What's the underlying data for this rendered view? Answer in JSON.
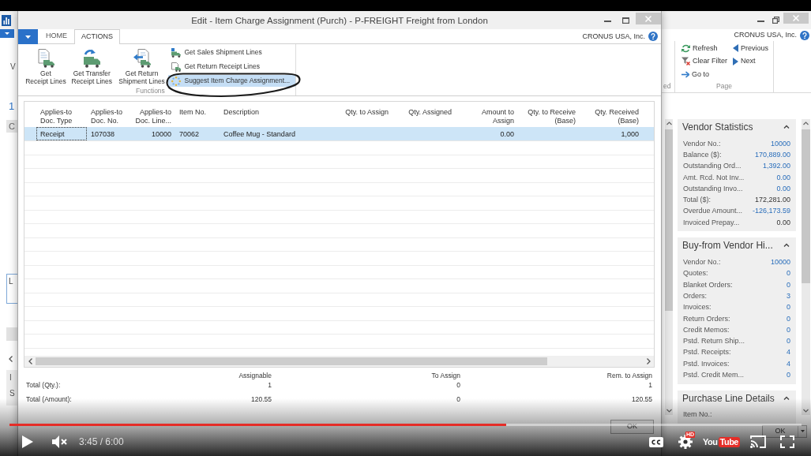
{
  "main_window": {
    "company": "CRONUS USA, Inc.",
    "left_fragments": [
      "V",
      "1",
      "C",
      "L",
      "I",
      "S"
    ],
    "ribbon": {
      "cut_group_label": "ed",
      "page_group": {
        "label": "Page",
        "columns": [
          [
            {
              "label": "Refresh",
              "kind": "refresh"
            },
            {
              "label": "Clear Filter",
              "kind": "clear_filter"
            },
            {
              "label": "Go to",
              "kind": "go_to"
            }
          ],
          [
            {
              "label": "Previous",
              "kind": "previous"
            },
            {
              "label": "Next",
              "kind": "next"
            }
          ]
        ]
      }
    },
    "factboxes": [
      {
        "title": "Vendor Statistics",
        "expanded": true,
        "fields": [
          {
            "label": "Vendor No.:",
            "value": "10000",
            "link": true
          },
          {
            "label": "Balance ($):",
            "value": "170,889.00",
            "link": true
          },
          {
            "label": "Outstanding Ord...",
            "value": "1,392.00",
            "link": true
          },
          {
            "label": "Amt. Rcd. Not Inv...",
            "value": "0.00",
            "link": true
          },
          {
            "label": "Outstanding Invo...",
            "value": "0.00",
            "link": true
          },
          {
            "label": "Total ($):",
            "value": "172,281.00",
            "link": false
          },
          {
            "label": "Overdue Amount...",
            "value": "-126,173.59",
            "link": true
          },
          {
            "label": "Invoiced Prepay...",
            "value": "0.00",
            "link": false
          }
        ]
      },
      {
        "title": "Buy-from Vendor Hi...",
        "expanded": true,
        "fields": [
          {
            "label": "Vendor No.:",
            "value": "10000",
            "link": true
          },
          {
            "label": "Quotes:",
            "value": "0",
            "link": true
          },
          {
            "label": "Blanket Orders:",
            "value": "0",
            "link": true
          },
          {
            "label": "Orders:",
            "value": "3",
            "link": true
          },
          {
            "label": "Invoices:",
            "value": "0",
            "link": true
          },
          {
            "label": "Return Orders:",
            "value": "0",
            "link": true
          },
          {
            "label": "Credit Memos:",
            "value": "0",
            "link": true
          },
          {
            "label": "Pstd. Return Ship...",
            "value": "0",
            "link": true
          },
          {
            "label": "Pstd. Receipts:",
            "value": "4",
            "link": true
          },
          {
            "label": "Pstd. Invoices:",
            "value": "4",
            "link": true
          },
          {
            "label": "Pstd. Credit Mem...",
            "value": "0",
            "link": true
          }
        ]
      },
      {
        "title": "Purchase Line Details",
        "expanded": true,
        "fields": [
          {
            "label": "Item No.:"
          }
        ]
      }
    ],
    "ok_button": "OK"
  },
  "dialog": {
    "title": "Edit - Item Charge Assignment (Purch) - P-FREIGHT Freight from London",
    "company": "CRONUS USA, Inc.",
    "tabs": [
      {
        "label": "HOME",
        "selected": false
      },
      {
        "label": "ACTIONS",
        "selected": true
      }
    ],
    "ribbon": {
      "group_label": "Functions",
      "large_actions": [
        {
          "lines": [
            "Get",
            "Receipt Lines"
          ],
          "kind": "receipt"
        },
        {
          "lines": [
            "Get Transfer",
            "Receipt Lines"
          ],
          "kind": "transfer"
        },
        {
          "lines": [
            "Get Return",
            "Shipment Lines"
          ],
          "kind": "return_shipment"
        }
      ],
      "small_actions": [
        {
          "label": "Get Sales Shipment Lines",
          "kind": "sales_shipment",
          "highlighted": false
        },
        {
          "label": "Get Return Receipt Lines",
          "kind": "return_receipt",
          "highlighted": false
        },
        {
          "label": "Suggest Item Charge Assignment...",
          "kind": "suggest",
          "highlighted": true
        }
      ]
    },
    "table": {
      "columns": [
        {
          "lines": [
            "Applies-to",
            "Doc. Type"
          ],
          "kind": "text"
        },
        {
          "lines": [
            "Applies-to",
            "Doc. No."
          ],
          "kind": "text"
        },
        {
          "lines": [
            "Applies-to",
            "Doc. Line..."
          ],
          "kind": "number"
        },
        {
          "lines": [
            "Item No."
          ],
          "kind": "text"
        },
        {
          "lines": [
            "Description"
          ],
          "kind": "text"
        },
        {
          "lines": [
            "Qty. to Assign"
          ],
          "kind": "number"
        },
        {
          "lines": [
            "Qty. Assigned"
          ],
          "kind": "number"
        },
        {
          "lines": [
            "Amount to",
            "Assign"
          ],
          "kind": "number"
        },
        {
          "lines": [
            "Qty. to Receive",
            "(Base)"
          ],
          "kind": "number"
        },
        {
          "lines": [
            "Qty. Received",
            "(Base)"
          ],
          "kind": "number"
        }
      ],
      "rows": [
        {
          "selected": true,
          "cells": [
            {
              "text": "Receipt",
              "focused": true
            },
            {
              "text": "107038",
              "focused": false
            },
            {
              "text": "10000",
              "focused": false
            },
            {
              "text": "70062",
              "focused": false
            },
            {
              "text": "Coffee Mug - Standard",
              "focused": false
            },
            null,
            null,
            {
              "text": "0.00",
              "focused": false
            },
            null,
            {
              "text": "1,000",
              "focused": false
            }
          ]
        }
      ]
    },
    "totals": {
      "columns": [
        "Assignable",
        "To Assign",
        "Rem. to Assign"
      ],
      "rows": [
        {
          "label": "Total (Qty.):",
          "values": [
            "1",
            "0",
            "1"
          ]
        },
        {
          "label": "Total (Amount):",
          "values": [
            "120.55",
            "0",
            "120.55"
          ]
        }
      ]
    },
    "ok_button": "OK"
  },
  "player": {
    "paused": true,
    "muted": true,
    "level": 0.627,
    "time": "3:45 / 6:00",
    "hd_badge": "HD",
    "logo": {
      "plain": "You",
      "boxed": "Tube"
    }
  }
}
